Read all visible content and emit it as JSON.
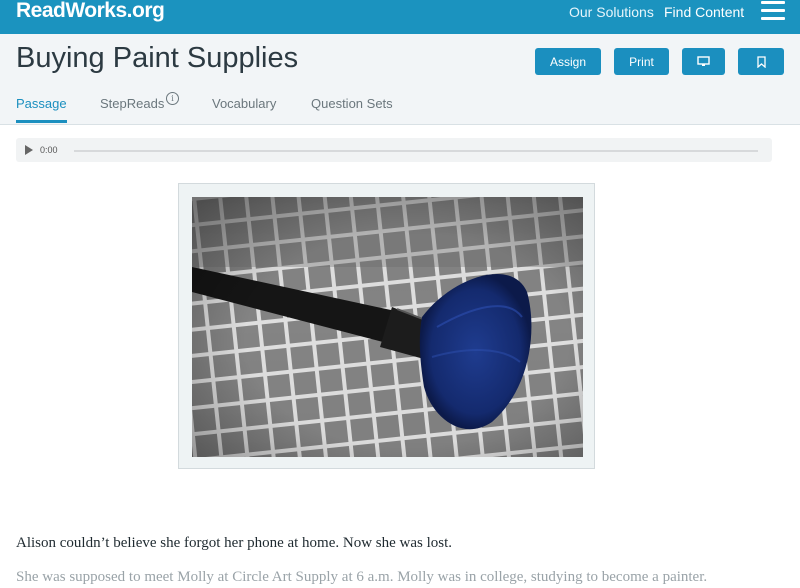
{
  "topbar": {
    "logo": "ReadWorks.org",
    "nav": [
      "Our Solutions",
      "Find Content"
    ],
    "menu_icon": "hamburger-icon"
  },
  "header": {
    "title": "Buying Paint Supplies",
    "buttons": {
      "assign": "Assign",
      "print": "Print",
      "present_icon": "monitor-icon",
      "bookmark_icon": "bookmark-icon"
    },
    "tabs": [
      "Passage",
      "StepReads",
      "Vocabulary",
      "Question Sets"
    ],
    "active_tab": "Passage",
    "stepreads_info_icon": "info-icon"
  },
  "audio": {
    "time": "0:00",
    "play_icon": "play-icon"
  },
  "passage": {
    "paragraphs": [
      "Alison couldn’t believe she forgot her phone at home. Now she was lost.",
      "She was supposed to meet Molly at Circle Art Supply at 6 a.m. Molly was in college, studying to become a painter."
    ]
  },
  "colors": {
    "brand": "#1b93bf",
    "button": "#1b8fbf",
    "header_bg": "#f2f5f7"
  }
}
